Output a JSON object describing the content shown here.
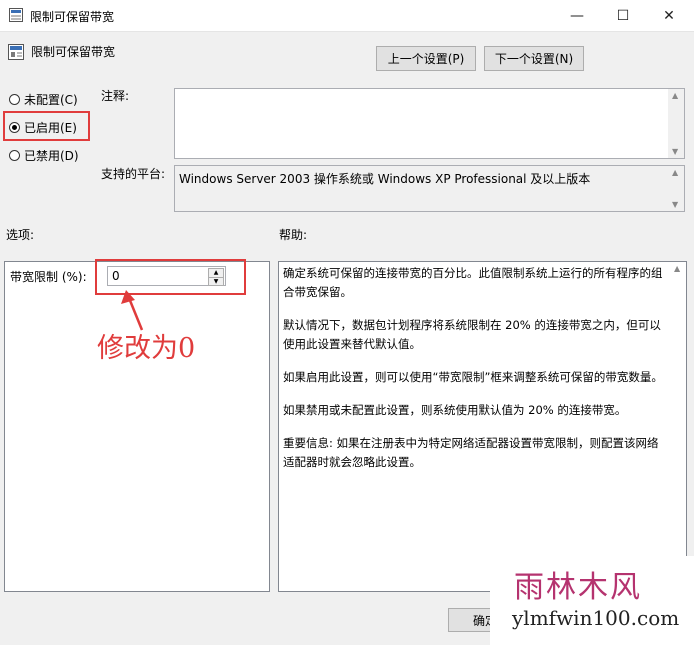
{
  "window": {
    "title": "限制可保留带宽",
    "minimize_glyph": "—",
    "maximize_glyph": "☐",
    "close_glyph": "✕"
  },
  "header": {
    "policy_name": "限制可保留带宽",
    "prev_button": "上一个设置(P)",
    "next_button": "下一个设置(N)"
  },
  "state": {
    "options": [
      {
        "label": "未配置(C)",
        "checked": false
      },
      {
        "label": "已启用(E)",
        "checked": true
      },
      {
        "label": "已禁用(D)",
        "checked": false
      }
    ]
  },
  "comment": {
    "label": "注释:",
    "value": ""
  },
  "platform": {
    "label": "支持的平台:",
    "value": "Windows Server 2003 操作系统或 Windows XP Professional 及以上版本"
  },
  "options_section": {
    "label": "选项:",
    "bandwidth_label": "带宽限制 (%):",
    "bandwidth_value": "0"
  },
  "help_section": {
    "label": "帮助:",
    "paragraphs": [
      "确定系统可保留的连接带宽的百分比。此值限制系统上运行的所有程序的组合带宽保留。",
      "默认情况下，数据包计划程序将系统限制在 20% 的连接带宽之内，但可以使用此设置来替代默认值。",
      "如果启用此设置，则可以使用“带宽限制”框来调整系统可保留的带宽数量。",
      "如果禁用或未配置此设置，则系统使用默认值为 20% 的连接带宽。",
      "重要信息: 如果在注册表中为特定网络适配器设置带宽限制，则配置该网络适配器时就会忽略此设置。"
    ]
  },
  "footer": {
    "ok_button_partial": "确定"
  },
  "annotation": {
    "text": "修改为0",
    "color": "#e03c3c"
  },
  "watermark": {
    "brand": "雨林木风",
    "url": "ylmfwin100.com"
  }
}
